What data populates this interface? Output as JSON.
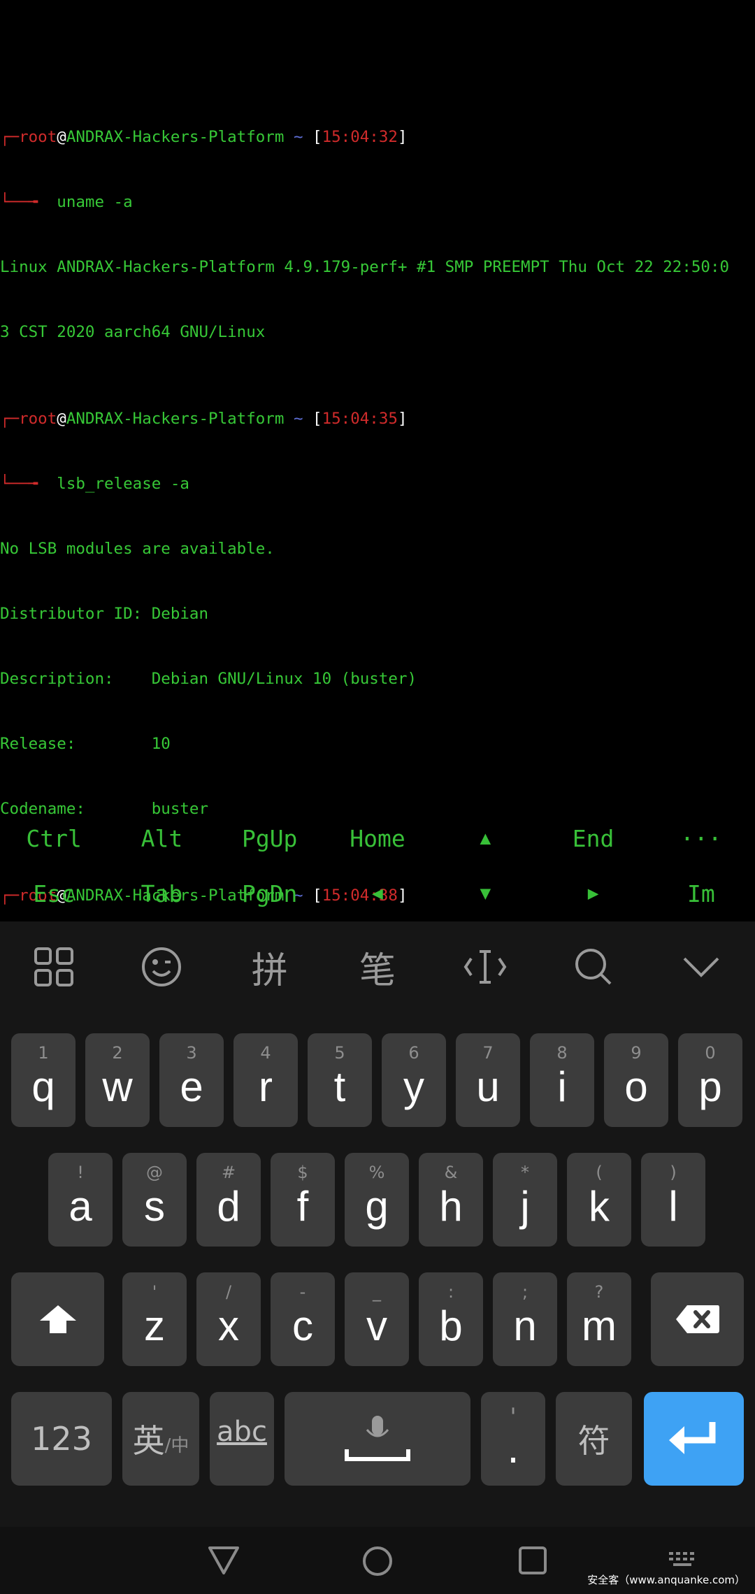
{
  "terminal": {
    "host": "ANDRAX-Hackers-Platform",
    "user": "root",
    "at": "@",
    "tilde": "~",
    "prompts": [
      {
        "time": "15:04:32",
        "command": "uname -a"
      },
      {
        "time": "15:04:35",
        "command": "lsb_release -a"
      },
      {
        "time": "15:04:38",
        "command": ""
      }
    ],
    "uname_output": [
      "Linux ANDRAX-Hackers-Platform 4.9.179-perf+ #1 SMP PREEMPT Thu Oct 22 22:50:0",
      "3 CST 2020 aarch64 GNU/Linux"
    ],
    "lsb_output": [
      "No LSB modules are available.",
      "Distributor ID: Debian",
      "Description:    Debian GNU/Linux 10 (buster)",
      "Release:        10",
      "Codename:       buster"
    ]
  },
  "extra_keys": {
    "row1": [
      "Ctrl",
      "Alt",
      "PgUp",
      "Home",
      "▲",
      "End",
      "···"
    ],
    "row2": [
      "Esc",
      "Tab",
      "PgDn",
      "◀",
      "▼",
      "▶",
      "Im"
    ]
  },
  "keyboard": {
    "toolbar": {
      "pinyin": "拼",
      "stroke": "笔"
    },
    "row1": [
      {
        "hint": "1",
        "key": "q"
      },
      {
        "hint": "2",
        "key": "w"
      },
      {
        "hint": "3",
        "key": "e"
      },
      {
        "hint": "4",
        "key": "r"
      },
      {
        "hint": "5",
        "key": "t"
      },
      {
        "hint": "6",
        "key": "y"
      },
      {
        "hint": "7",
        "key": "u"
      },
      {
        "hint": "8",
        "key": "i"
      },
      {
        "hint": "9",
        "key": "o"
      },
      {
        "hint": "0",
        "key": "p"
      }
    ],
    "row2": [
      {
        "hint": "!",
        "key": "a"
      },
      {
        "hint": "@",
        "key": "s"
      },
      {
        "hint": "#",
        "key": "d"
      },
      {
        "hint": "$",
        "key": "f"
      },
      {
        "hint": "%",
        "key": "g"
      },
      {
        "hint": "&",
        "key": "h"
      },
      {
        "hint": "*",
        "key": "j"
      },
      {
        "hint": "(",
        "key": "k"
      },
      {
        "hint": ")",
        "key": "l"
      }
    ],
    "row3": [
      {
        "hint": "'",
        "key": "z"
      },
      {
        "hint": "/",
        "key": "x"
      },
      {
        "hint": "-",
        "key": "c"
      },
      {
        "hint": "_",
        "key": "v"
      },
      {
        "hint": ":",
        "key": "b"
      },
      {
        "hint": ";",
        "key": "n"
      },
      {
        "hint": "?",
        "key": "m"
      }
    ],
    "bottom": {
      "numbers": "123",
      "lang_main": "英",
      "lang_sub": "/中",
      "abc": "abc",
      "comma": "'",
      "period": ".",
      "symbols": "符"
    }
  },
  "watermark": "安全客（www.anquanke.com）",
  "colors": {
    "terminal_green": "#37c837",
    "prompt_red": "#d02b2b",
    "enter_blue": "#3ea2f4",
    "key_bg": "#3c3c3c"
  }
}
